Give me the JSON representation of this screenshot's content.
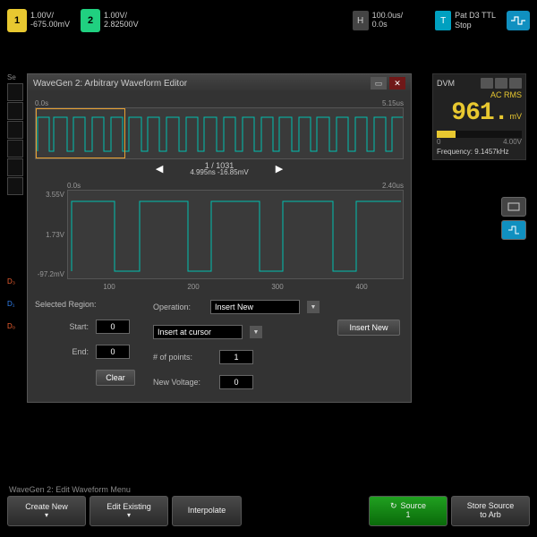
{
  "topbar": {
    "ch1": {
      "badge": "1",
      "scale": "1.00V/",
      "offset": "-675.00mV"
    },
    "ch2": {
      "badge": "2",
      "scale": "1.00V/",
      "offset": "2.82500V"
    },
    "h": {
      "badge": "H",
      "scale": "100.0us/",
      "offset": "0.0s"
    },
    "trig": {
      "badge": "T",
      "line1": "Pat   D3   TTL",
      "line2": "Stop"
    }
  },
  "dvm": {
    "title": "DVM",
    "mode": "AC RMS",
    "digits": "961.",
    "unit": "mV",
    "scale_min": "0",
    "scale_max": "4.00V",
    "freq_label": "Frequency:",
    "freq_value": "9.1457kHz"
  },
  "dialog": {
    "title": "WaveGen 2: Arbitrary Waveform Editor",
    "overview": {
      "t_start": "0.0s",
      "t_end": "5.15us"
    },
    "nav": {
      "index": "1 / 1031",
      "center": "4.995ns  -16.85mV"
    },
    "detail": {
      "t_start": "0.0s",
      "t_end": "2.40us",
      "y_top": "3.55V",
      "y_mid": "1.73V",
      "y_bot": "-97.2mV",
      "x_ticks": [
        "100",
        "200",
        "300",
        "400"
      ]
    },
    "form": {
      "region_label": "Selected Region:",
      "op_label": "Operation:",
      "op_value": "Insert New",
      "start_label": "Start:",
      "start_value": "0",
      "end_label": "End:",
      "end_value": "0",
      "clear": "Clear",
      "insert_at_label": "Insert at cursor",
      "npoints_label": "# of points:",
      "npoints_value": "1",
      "newv_label": "New Voltage:",
      "newv_value": "0",
      "insert_btn": "Insert New"
    }
  },
  "bottom": {
    "menu_label": "WaveGen 2: Edit Waveform Menu",
    "b1": "Create New",
    "b2": "Edit Existing",
    "b3": "Interpolate",
    "b4a": "Source",
    "b4b": "1",
    "b5a": "Store Source",
    "b5b": "to Arb"
  },
  "leftstrip": {
    "label": "Se"
  },
  "dlabels": {
    "d3": "D₃",
    "d1": "D₁",
    "d0": "D₀"
  }
}
